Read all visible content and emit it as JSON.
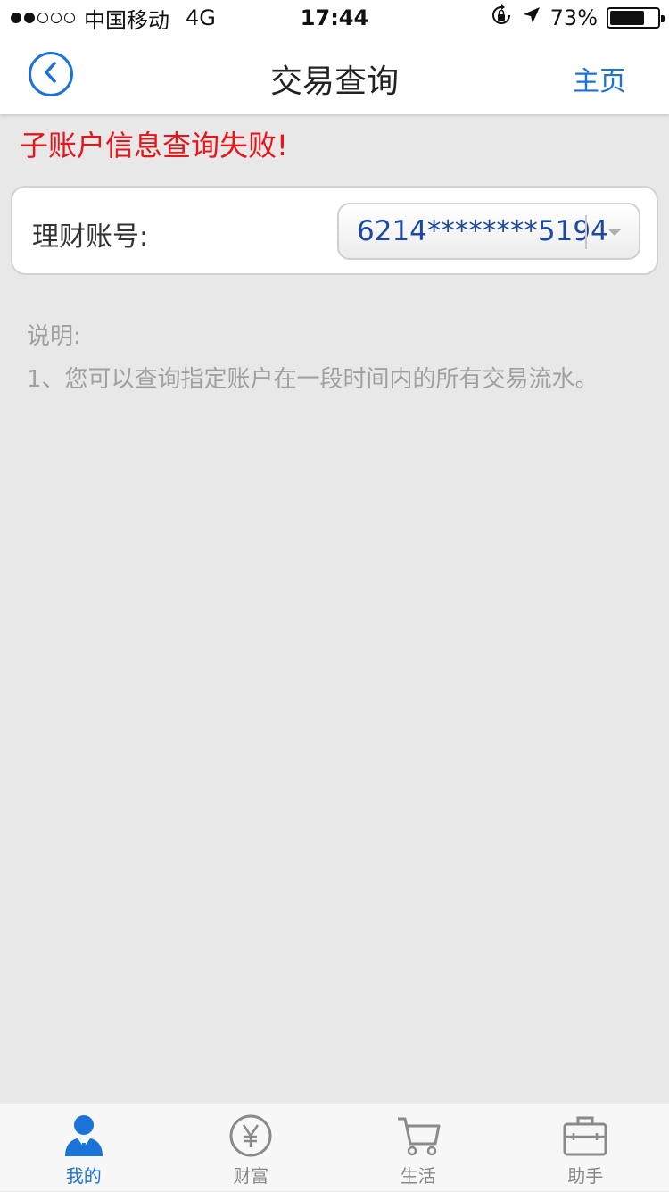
{
  "status_bar": {
    "carrier": "中国移动",
    "network": "4G",
    "time": "17:44",
    "battery": "73%",
    "battery_level": 0.73
  },
  "nav": {
    "title": "交易查询",
    "home_label": "主页",
    "back_icon": "chevron-left-circle-icon"
  },
  "error_message": "子账户信息查询失败!",
  "account": {
    "label": "理财账号:",
    "selected_value": "6214********5194"
  },
  "notes": {
    "title": "说明:",
    "items": [
      "1、您可以查询指定账户在一段时间内的所有交易流水。"
    ]
  },
  "tabs": [
    {
      "label": "我的",
      "icon": "person-icon",
      "active": true
    },
    {
      "label": "财富",
      "icon": "yen-icon",
      "active": false
    },
    {
      "label": "生活",
      "icon": "cart-icon",
      "active": false
    },
    {
      "label": "助手",
      "icon": "briefcase-icon",
      "active": false
    }
  ],
  "colors": {
    "accent": "#1a73d9",
    "error": "#e8141a",
    "background": "#e8e8e8",
    "account_value": "#1d4aa0"
  }
}
